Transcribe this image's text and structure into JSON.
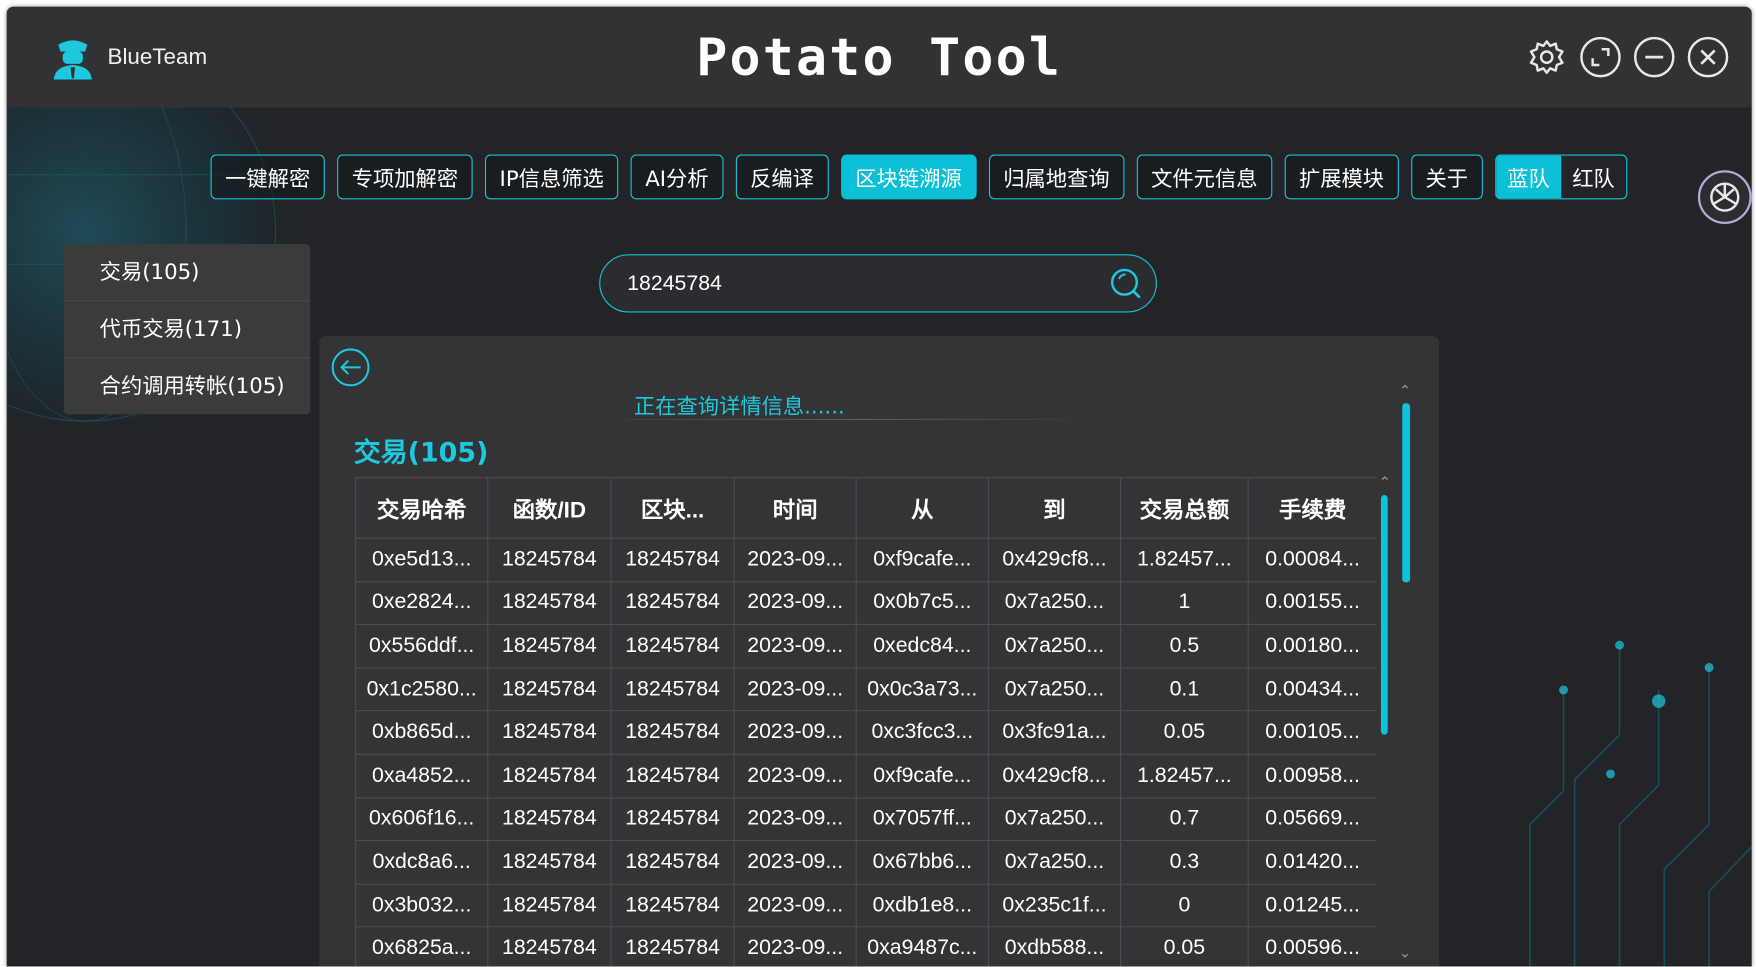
{
  "app": {
    "brand": "BlueTeam",
    "title": "Potato Tool"
  },
  "nav": [
    {
      "label": "一键解密",
      "active": false
    },
    {
      "label": "专项加解密",
      "active": false
    },
    {
      "label": "IP信息筛选",
      "active": false
    },
    {
      "label": "AI分析",
      "active": false
    },
    {
      "label": "反编译",
      "active": false
    },
    {
      "label": "区块链溯源",
      "active": true
    },
    {
      "label": "归属地查询",
      "active": false
    },
    {
      "label": "文件元信息",
      "active": false
    },
    {
      "label": "扩展模块",
      "active": false
    },
    {
      "label": "关于",
      "active": false
    }
  ],
  "team": {
    "blue": "蓝队",
    "red": "红队",
    "selected": "blue"
  },
  "side_menu": [
    {
      "label": "交易(105)"
    },
    {
      "label": "代币交易(171)"
    },
    {
      "label": "合约调用转帐(105)"
    }
  ],
  "search": {
    "value": "18245784"
  },
  "panel": {
    "status": "正在查询详情信息......",
    "section_title": "交易(105)"
  },
  "table": {
    "columns": [
      "交易哈希",
      "函数/ID",
      "区块...",
      "时间",
      "从",
      "到",
      "交易总额",
      "手续费"
    ],
    "rows": [
      [
        "0xe5d13...",
        "18245784",
        "18245784",
        "2023-09...",
        "0xf9cafe...",
        "0x429cf8...",
        "1.82457...",
        "0.00084..."
      ],
      [
        "0xe2824...",
        "18245784",
        "18245784",
        "2023-09...",
        "0x0b7c5...",
        "0x7a250...",
        "1",
        "0.00155..."
      ],
      [
        "0x556ddf...",
        "18245784",
        "18245784",
        "2023-09...",
        "0xedc84...",
        "0x7a250...",
        "0.5",
        "0.00180..."
      ],
      [
        "0x1c2580...",
        "18245784",
        "18245784",
        "2023-09...",
        "0x0c3a73...",
        "0x7a250...",
        "0.1",
        "0.00434..."
      ],
      [
        "0xb865d...",
        "18245784",
        "18245784",
        "2023-09...",
        "0xc3fcc3...",
        "0x3fc91a...",
        "0.05",
        "0.00105..."
      ],
      [
        "0xa4852...",
        "18245784",
        "18245784",
        "2023-09...",
        "0xf9cafe...",
        "0x429cf8...",
        "1.82457...",
        "0.00958..."
      ],
      [
        "0x606f16...",
        "18245784",
        "18245784",
        "2023-09...",
        "0x7057ff...",
        "0x7a250...",
        "0.7",
        "0.05669..."
      ],
      [
        "0xdc8a6...",
        "18245784",
        "18245784",
        "2023-09...",
        "0x67bb6...",
        "0x7a250...",
        "0.3",
        "0.01420..."
      ],
      [
        "0x3b032...",
        "18245784",
        "18245784",
        "2023-09...",
        "0xdb1e8...",
        "0x235c1f...",
        "0",
        "0.01245..."
      ],
      [
        "0x6825a...",
        "18245784",
        "18245784",
        "2023-09...",
        "0xa9487c...",
        "0xdb588...",
        "0.05",
        "0.00596..."
      ]
    ]
  },
  "colors": {
    "accent": "#0bc0d6",
    "background": "#222427",
    "titlebar": "#313233"
  }
}
